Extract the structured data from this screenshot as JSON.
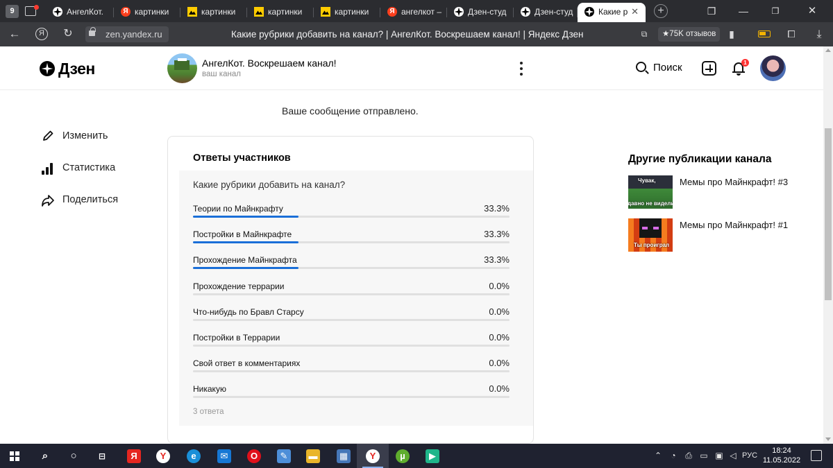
{
  "browser": {
    "tab_count": "9",
    "tabs": [
      {
        "label": "АнгелКот.",
        "favicon": "zen-icon"
      },
      {
        "label": "картинки",
        "favicon": "yandex-icon"
      },
      {
        "label": "картинки",
        "favicon": "image-search-icon"
      },
      {
        "label": "картинки",
        "favicon": "image-search-icon"
      },
      {
        "label": "картинки",
        "favicon": "image-search-icon"
      },
      {
        "label": "ангелкот –",
        "favicon": "yandex-icon"
      },
      {
        "label": "Дзен-студ",
        "favicon": "zen-icon"
      },
      {
        "label": "Дзен-студ",
        "favicon": "zen-icon"
      },
      {
        "label": "Какие р",
        "favicon": "zen-icon",
        "active": true
      }
    ],
    "new_tab": "+",
    "url": "zen.yandex.ru",
    "page_title": "Какие рубрики добавить на канал? | АнгелКот. Воскрешаем канал! | Яндекс Дзен",
    "reviews_badge": "★75K отзывов"
  },
  "header": {
    "logo_text": "Дзен",
    "channel_name": "АнгелКот. Воскрешаем канал!",
    "channel_sub": "ваш канал",
    "search_label": "Поиск",
    "notification_count": "1"
  },
  "message": "Ваше сообщение отправлено.",
  "side_nav": [
    {
      "label": "Изменить",
      "icon": "pencil-icon"
    },
    {
      "label": "Статистика",
      "icon": "stats-icon"
    },
    {
      "label": "Поделиться",
      "icon": "share-icon"
    }
  ],
  "poll": {
    "card_title": "Ответы участников",
    "question": "Какие рубрики добавить на канал?",
    "accent_color": "#1a6fd8",
    "options": [
      {
        "label": "Теории по Майнкрафту",
        "percent_text": "33.3%",
        "fraction": 0.333
      },
      {
        "label": "Постройки в Майнкрафте",
        "percent_text": "33.3%",
        "fraction": 0.333
      },
      {
        "label": "Прохождение Майнкрафта",
        "percent_text": "33.3%",
        "fraction": 0.333
      },
      {
        "label": "Прохождение террарии",
        "percent_text": "0.0%",
        "fraction": 0
      },
      {
        "label": "Что-нибудь по Бравл Старсу",
        "percent_text": "0.0%",
        "fraction": 0
      },
      {
        "label": "Постройки в Террарии",
        "percent_text": "0.0%",
        "fraction": 0
      },
      {
        "label": "Свой ответ в комментариях",
        "percent_text": "0.0%",
        "fraction": 0
      },
      {
        "label": "Никакую",
        "percent_text": "0.0%",
        "fraction": 0
      }
    ],
    "answers_count": "3 ответа"
  },
  "aside": {
    "title": "Другие публикации канала",
    "publications": [
      {
        "title": "Мемы про Майнкрафт! #3",
        "thumb_caption_top": "Чувак,",
        "thumb_caption_bottom": "давно не виделись"
      },
      {
        "title": "Мемы про Майнкрафт! #1",
        "thumb_caption_top": "",
        "thumb_caption_bottom": "Ты проиграл"
      }
    ]
  },
  "taskbar": {
    "language": "РУС",
    "time": "18:24",
    "date": "11.05.2022"
  }
}
